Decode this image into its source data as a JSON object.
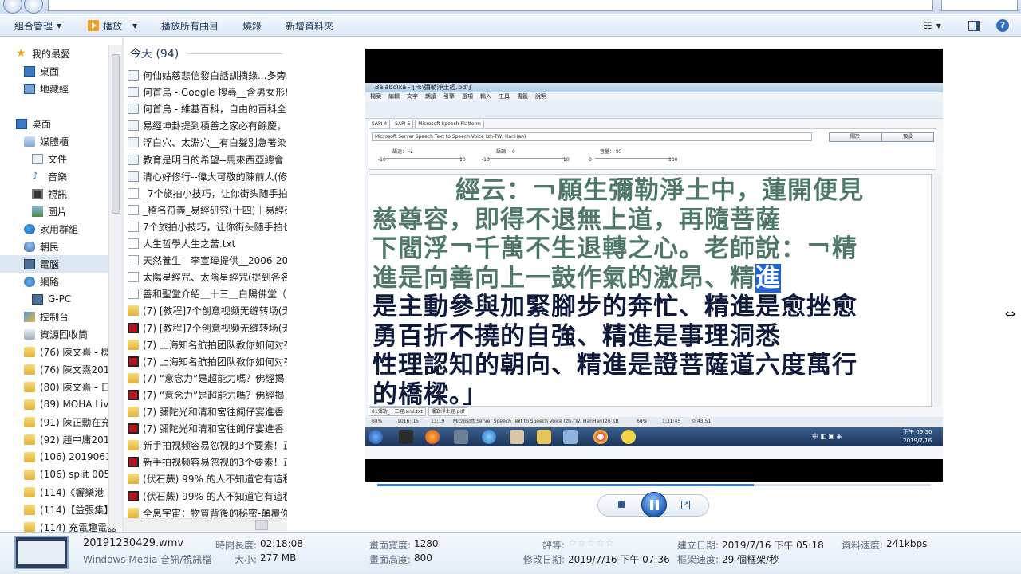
{
  "toolbar": {
    "organize": "組合管理",
    "play": "播放",
    "play_all": "播放所有曲目",
    "burn": "燒錄",
    "new_folder": "新增資料夾"
  },
  "sidebar": {
    "favorites": "我的最愛",
    "desktop_fav": "桌面",
    "map": "地藏經",
    "desktop": "桌面",
    "library": "媒體櫃",
    "documents": "文件",
    "music": "音樂",
    "videos": "視訊",
    "pictures": "圖片",
    "homegroup": "家用群組",
    "user": "朝民",
    "computer": "電腦",
    "network": "網路",
    "gpc": "G-PC",
    "control": "控制台",
    "recycle": "資源回收筒",
    "folders": [
      "(76) 陳文熹 - 概",
      "(76) 陳文熹2019",
      "(80) 陳文熹 - 日",
      "(89) MOHA Liv",
      "(91) 陳正勳在充",
      "(92) 趙中庸2019",
      "(106) 20190619",
      "(106) split 005g",
      "(114)《響樂港",
      "(114)【益張集】",
      "(114) 充電趣電器"
    ]
  },
  "filelist": {
    "group": "今天 (94)",
    "files": [
      {
        "name": "何仙姑慈悲信發白話訓摘錄...多旁...",
        "type": "web"
      },
      {
        "name": "何首烏 - Google 搜尋__含男女形象",
        "type": "web"
      },
      {
        "name": "何首烏 - 維基百科，自由的百科全書",
        "type": "web"
      },
      {
        "name": "易經坤卦提到積善之家必有餘慶，",
        "type": "web"
      },
      {
        "name": "浮白穴、太淵穴__有白髮別急著染",
        "type": "web"
      },
      {
        "name": "教育是明日的希望--馬來西亞總會",
        "type": "web"
      },
      {
        "name": "清心好修行--偉大可敬的陳前人(修",
        "type": "web"
      },
      {
        "name": "_7个旅拍小技巧，让你街头随手拍",
        "type": "txt"
      },
      {
        "name": "_稽名符義_易經研究(十四)｜易經研",
        "type": "txt"
      },
      {
        "name": "7个旅拍小技巧，让你街头随手拍也",
        "type": "txt"
      },
      {
        "name": "人生哲學人生之苦.txt",
        "type": "txt"
      },
      {
        "name": "天然養生　李宣瑋提供__2006-200",
        "type": "txt"
      },
      {
        "name": "太陽星經咒、太陰星經咒(提到各名",
        "type": "txt"
      },
      {
        "name": "善和聖堂介紹＿十三＿白陽佛堂（",
        "type": "txt"
      },
      {
        "name": "(7) [教程]7个创意视频无缝转场(无",
        "type": "folder"
      },
      {
        "name": "(7) [教程]7个创意视频无缝转场(无",
        "type": "video"
      },
      {
        "name": "(7) 上海知名航拍团队教你如何对夜",
        "type": "folder"
      },
      {
        "name": "(7) 上海知名航拍团队教你如何对夜",
        "type": "video"
      },
      {
        "name": "(7) “意念力”是超能力嗎？佛經揭",
        "type": "folder"
      },
      {
        "name": "(7) “意念力”是超能力嗎？佛經揭",
        "type": "video"
      },
      {
        "name": "(7) 彌陀光和清和宮往飼仔宴進香 -",
        "type": "folder"
      },
      {
        "name": "(7) 彌陀光和清和宮往飼仔宴進香 -",
        "type": "video"
      },
      {
        "name": "新手拍视频容易忽视的3个要素！正",
        "type": "folder"
      },
      {
        "name": "新手拍视频容易忽视的3个要素！正",
        "type": "video"
      },
      {
        "name": "(伏石蕨) 99% 的人不知道它有這種",
        "type": "folder"
      },
      {
        "name": "(伏石蕨) 99% 的人不知道它有這種",
        "type": "video"
      },
      {
        "name": "全息宇宙：物質背後的秘密-顛覆你",
        "type": "folder"
      }
    ]
  },
  "video": {
    "app_title": "Balabolka - [H:\\彌勒淨土經.pdf]",
    "menu": [
      "檔案",
      "編輯",
      "文字",
      "朗讀",
      "引擎",
      "選項",
      "輸入",
      "工具",
      "書籤",
      "說明"
    ],
    "tabs": [
      "SAPI 4",
      "SAPI 5",
      "Microsoft Speech Platform"
    ],
    "voice": "Microsoft Server Speech Text to Speech Voice (zh-TW, HanHan)",
    "btn_about": "關於",
    "btn_default": "預設",
    "rate_label": "語速：",
    "rate": "-2",
    "pitch_label": "語調：",
    "pitch": "0",
    "volume_label": "音量：",
    "volume": "95",
    "slider_marks": [
      "-10",
      "10",
      "-10",
      "10",
      "0",
      "100"
    ],
    "text_lines": [
      {
        "read": "經云：￢願生彌勒淨土中，蓮開便見",
        "unread": "",
        "hl": ""
      },
      {
        "read": "慈尊容，即得不退無上道，再隨菩薩",
        "unread": "",
        "hl": ""
      },
      {
        "read": "下閻浮￢千萬不生退轉之心。老師說：￢精",
        "unread": "",
        "hl": ""
      },
      {
        "read": "進是向善向上一鼓作氣的激昂、精",
        "unread": "",
        "hl": "進"
      },
      {
        "read": "",
        "unread": "是主動參與加緊腳步的奔忙、精進是愈挫愈",
        "hl": ""
      },
      {
        "read": "",
        "unread": "勇百折不撓的自強、精進是事理洞悉",
        "hl": ""
      },
      {
        "read": "",
        "unread": "性理認知的朝向、精進是證菩薩道六度萬行",
        "hl": ""
      },
      {
        "read": "",
        "unread": "的橋樑。」",
        "hl": ""
      }
    ],
    "doc_tabs": [
      "01彌勒_十三經.xml.txt",
      "彌勒淨土經.pdf"
    ],
    "status": [
      "68%",
      "1016: 15",
      "13:19",
      "Microsoft Server Speech Text to Speech Voice (zh-TW, HanHan)",
      "26 KB",
      "68%",
      "1:31:45",
      "0:43:51"
    ],
    "clock_time": "下午 06:50",
    "clock_date": "2019/7/16",
    "tray": "中 ◧ ▣ ◈"
  },
  "player": {
    "progress": 0.68
  },
  "details": {
    "filename": "20191230429.wmv",
    "filetype": "Windows Media 音訊/視訊檔",
    "length_label": "時間長度:",
    "length": "02:18:08",
    "size_label": "大小:",
    "size": "277 MB",
    "width_label": "畫面寬度:",
    "width": "1280",
    "height_label": "畫面高度:",
    "height": "800",
    "rating_label": "評等:",
    "rating": "☆☆☆☆☆",
    "modified_label": "修改日期:",
    "modified": "2019/7/16 下午 07:36",
    "created_label": "建立日期:",
    "created": "2019/7/16 下午 05:18",
    "framerate_label": "框架速度:",
    "framerate": "29 個框架/秒",
    "datarate_label": "資料速度:",
    "datarate": "241kbps"
  }
}
